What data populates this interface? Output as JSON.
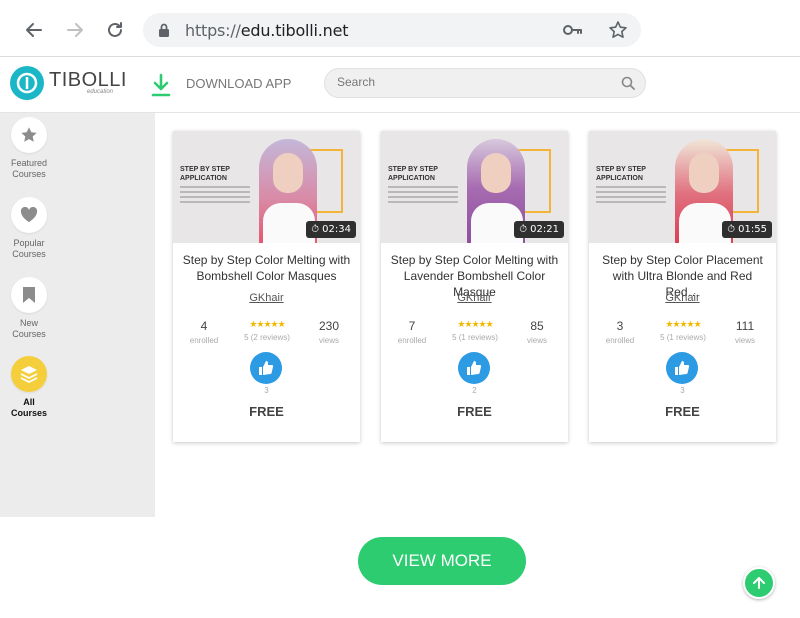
{
  "browser": {
    "url_protocol": "https://",
    "url_host": "edu.tibolli.net"
  },
  "header": {
    "logo_text": "TIBOLLI",
    "logo_sub": "education",
    "download_label": "DOWNLOAD APP",
    "search_placeholder": "Search"
  },
  "sidebar": {
    "items": [
      {
        "label": "Featured Courses",
        "icon": "star-icon",
        "active": false
      },
      {
        "label": "Popular Courses",
        "icon": "heart-icon",
        "active": false
      },
      {
        "label": "New Courses",
        "icon": "bookmark-icon",
        "active": false
      },
      {
        "label": "All Courses",
        "icon": "layers-icon",
        "active": true
      }
    ]
  },
  "courses": [
    {
      "thumb_title": "STEP BY STEP APPLICATION",
      "duration": "02:34",
      "title": "Step by Step Color Melting with Bombshell Color Masques",
      "author": "GKhair",
      "enrolled": "4",
      "enrolled_label": "enrolled",
      "reviews": "5 (2 reviews)",
      "views": "230",
      "views_label": "views",
      "likes": "3",
      "price": "FREE",
      "hair_color": "#d98aa6"
    },
    {
      "thumb_title": "STEP BY STEP APPLICATION",
      "duration": "02:21",
      "title": "Step by Step Color Melting with Lavender Bombshell Color Masque",
      "author": "GKhair",
      "enrolled": "7",
      "enrolled_label": "enrolled",
      "reviews": "5 (1 reviews)",
      "views": "85",
      "views_label": "views",
      "likes": "2",
      "price": "FREE",
      "hair_color": "#a66bb0"
    },
    {
      "thumb_title": "STEP BY STEP APPLICATION",
      "duration": "01:55",
      "title": "Step by Step Color Placement with Ultra Blonde and Red Red…",
      "author": "GKhair",
      "enrolled": "3",
      "enrolled_label": "enrolled",
      "reviews": "5 (1 reviews)",
      "views": "111",
      "views_label": "views",
      "likes": "3",
      "price": "FREE",
      "hair_color": "#e0707e"
    }
  ],
  "view_more_label": "VIEW MORE",
  "colors": {
    "accent_green": "#2ecc71",
    "brand_teal": "#1bb7c7",
    "active_yellow": "#f5cf3b",
    "like_blue": "#2d9be4"
  }
}
